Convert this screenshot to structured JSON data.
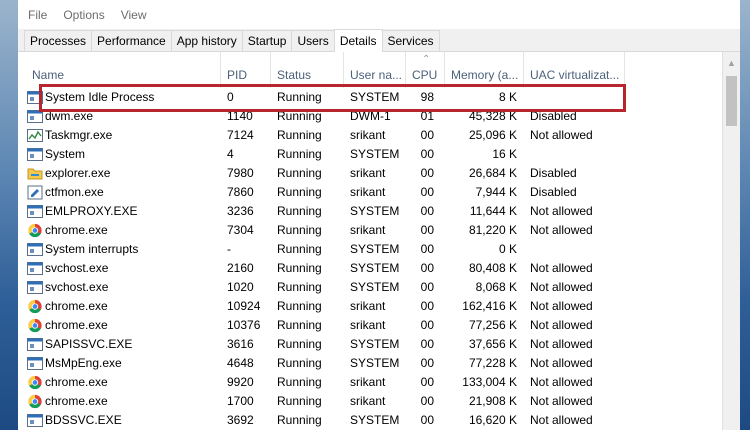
{
  "menu": [
    "File",
    "Options",
    "View"
  ],
  "tabs": [
    {
      "label": "Processes",
      "active": false
    },
    {
      "label": "Performance",
      "active": false
    },
    {
      "label": "App history",
      "active": false
    },
    {
      "label": "Startup",
      "active": false
    },
    {
      "label": "Users",
      "active": false
    },
    {
      "label": "Details",
      "active": true
    },
    {
      "label": "Services",
      "active": false
    }
  ],
  "columns": [
    {
      "key": "name",
      "label": "Name"
    },
    {
      "key": "pid",
      "label": "PID"
    },
    {
      "key": "status",
      "label": "Status"
    },
    {
      "key": "user",
      "label": "User na..."
    },
    {
      "key": "cpu",
      "label": "CPU"
    },
    {
      "key": "memory",
      "label": "Memory (a..."
    },
    {
      "key": "uac",
      "label": "UAC virtualizat..."
    }
  ],
  "sort_indicator": "^",
  "rows": [
    {
      "icon": "window-app-icon",
      "name": "System Idle Process",
      "pid": "0",
      "status": "Running",
      "user": "SYSTEM",
      "cpu": "98",
      "memory": "8 K",
      "uac": ""
    },
    {
      "icon": "window-app-icon",
      "name": "dwm.exe",
      "pid": "1140",
      "status": "Running",
      "user": "DWM-1",
      "cpu": "01",
      "memory": "45,328 K",
      "uac": "Disabled"
    },
    {
      "icon": "task-manager-icon",
      "name": "Taskmgr.exe",
      "pid": "7124",
      "status": "Running",
      "user": "srikant",
      "cpu": "00",
      "memory": "25,096 K",
      "uac": "Not allowed"
    },
    {
      "icon": "window-app-icon",
      "name": "System",
      "pid": "4",
      "status": "Running",
      "user": "SYSTEM",
      "cpu": "00",
      "memory": "16 K",
      "uac": ""
    },
    {
      "icon": "file-explorer-icon",
      "name": "explorer.exe",
      "pid": "7980",
      "status": "Running",
      "user": "srikant",
      "cpu": "00",
      "memory": "26,684 K",
      "uac": "Disabled"
    },
    {
      "icon": "ctfmon-icon",
      "name": "ctfmon.exe",
      "pid": "7860",
      "status": "Running",
      "user": "srikant",
      "cpu": "00",
      "memory": "7,944 K",
      "uac": "Disabled"
    },
    {
      "icon": "window-app-icon",
      "name": "EMLPROXY.EXE",
      "pid": "3236",
      "status": "Running",
      "user": "SYSTEM",
      "cpu": "00",
      "memory": "11,644 K",
      "uac": "Not allowed"
    },
    {
      "icon": "chrome-icon",
      "name": "chrome.exe",
      "pid": "7304",
      "status": "Running",
      "user": "srikant",
      "cpu": "00",
      "memory": "81,220 K",
      "uac": "Not allowed"
    },
    {
      "icon": "window-app-icon",
      "name": "System interrupts",
      "pid": "-",
      "status": "Running",
      "user": "SYSTEM",
      "cpu": "00",
      "memory": "0 K",
      "uac": ""
    },
    {
      "icon": "window-app-icon",
      "name": "svchost.exe",
      "pid": "2160",
      "status": "Running",
      "user": "SYSTEM",
      "cpu": "00",
      "memory": "80,408 K",
      "uac": "Not allowed"
    },
    {
      "icon": "window-app-icon",
      "name": "svchost.exe",
      "pid": "1020",
      "status": "Running",
      "user": "SYSTEM",
      "cpu": "00",
      "memory": "8,068 K",
      "uac": "Not allowed"
    },
    {
      "icon": "chrome-icon",
      "name": "chrome.exe",
      "pid": "10924",
      "status": "Running",
      "user": "srikant",
      "cpu": "00",
      "memory": "162,416 K",
      "uac": "Not allowed"
    },
    {
      "icon": "chrome-icon",
      "name": "chrome.exe",
      "pid": "10376",
      "status": "Running",
      "user": "srikant",
      "cpu": "00",
      "memory": "77,256 K",
      "uac": "Not allowed"
    },
    {
      "icon": "window-app-icon",
      "name": "SAPISSVC.EXE",
      "pid": "3616",
      "status": "Running",
      "user": "SYSTEM",
      "cpu": "00",
      "memory": "37,656 K",
      "uac": "Not allowed"
    },
    {
      "icon": "window-app-icon",
      "name": "MsMpEng.exe",
      "pid": "4648",
      "status": "Running",
      "user": "SYSTEM",
      "cpu": "00",
      "memory": "77,228 K",
      "uac": "Not allowed"
    },
    {
      "icon": "chrome-icon",
      "name": "chrome.exe",
      "pid": "9920",
      "status": "Running",
      "user": "srikant",
      "cpu": "00",
      "memory": "133,004 K",
      "uac": "Not allowed"
    },
    {
      "icon": "chrome-icon",
      "name": "chrome.exe",
      "pid": "1700",
      "status": "Running",
      "user": "srikant",
      "cpu": "00",
      "memory": "21,908 K",
      "uac": "Not allowed"
    },
    {
      "icon": "window-app-icon",
      "name": "BDSSVC.EXE",
      "pid": "3692",
      "status": "Running",
      "user": "SYSTEM",
      "cpu": "00",
      "memory": "16,620 K",
      "uac": "Not allowed"
    }
  ],
  "colors": {
    "highlight_border": "#b7262d",
    "header_text": "#4c607a",
    "tab_background": "#f0f0f0"
  }
}
